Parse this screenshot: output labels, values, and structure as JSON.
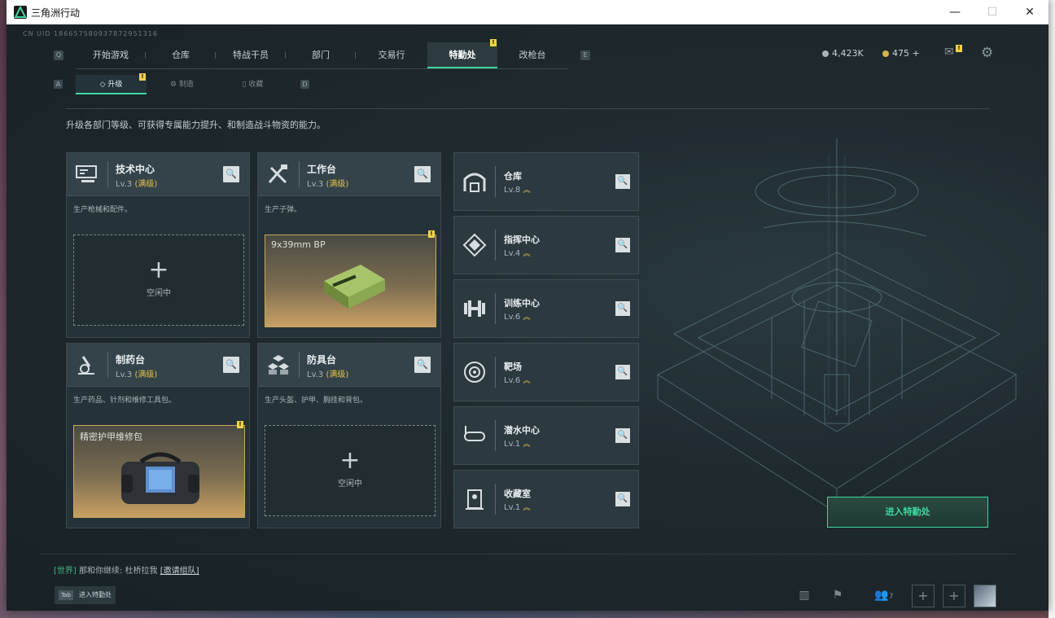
{
  "window": {
    "title": "三角洲行动",
    "controls": {
      "minimize": "—",
      "maximize": "☐",
      "close": "✕"
    }
  },
  "uid": "CN UID 186657580937872951316",
  "nav": {
    "key_left": "Q",
    "key_right": "E",
    "tabs": [
      "开始游戏",
      "仓库",
      "特战干员",
      "部门",
      "交易行",
      "特勤处",
      "改枪台"
    ],
    "active_tab": "特勤处",
    "active_badge": "!"
  },
  "currency": {
    "silver": "4,423K",
    "gold": "475",
    "gold_add": "+"
  },
  "mail_badge": "!",
  "subnav": {
    "key_left": "A",
    "key_right": "D",
    "tabs": [
      "升级",
      "制造",
      "收藏"
    ],
    "active": "升级",
    "badge": "!"
  },
  "description": "升级各部门等级、可获得专属能力提升、和制造战斗物资的能力。",
  "workbenches": [
    {
      "name": "技术中心",
      "level": "Lv.3",
      "max": "(满级)",
      "sub": "生产枪械和配件。",
      "slot": "idle",
      "idle_text": "空闲中",
      "icon": "tech-center-icon"
    },
    {
      "name": "工作台",
      "level": "Lv.3",
      "max": "(满级)",
      "sub": "生产子弹。",
      "slot": "item",
      "item_name": "9x39mm BP",
      "badge": "!",
      "icon": "workbench-icon"
    },
    {
      "name": "制药台",
      "level": "Lv.3",
      "max": "(满级)",
      "sub": "生产药品、针剂和维修工具包。",
      "slot": "item",
      "item_name": "精密护甲维修包",
      "badge": "!",
      "icon": "pharmacy-icon"
    },
    {
      "name": "防具台",
      "level": "Lv.3",
      "max": "(满级)",
      "sub": "生产头盔、护甲、胸挂和背包。",
      "slot": "idle",
      "idle_text": "空闲中",
      "icon": "armor-bench-icon"
    }
  ],
  "facilities": [
    {
      "name": "仓库",
      "level": "Lv.8",
      "icon": "warehouse-icon"
    },
    {
      "name": "指挥中心",
      "level": "Lv.4",
      "icon": "command-center-icon"
    },
    {
      "name": "训练中心",
      "level": "Lv.6",
      "icon": "training-center-icon"
    },
    {
      "name": "靶场",
      "level": "Lv.6",
      "icon": "shooting-range-icon"
    },
    {
      "name": "潜水中心",
      "level": "Lv.1",
      "icon": "dive-center-icon"
    },
    {
      "name": "收藏室",
      "level": "Lv.1",
      "icon": "collection-room-icon"
    }
  ],
  "level_up_mark": "︽",
  "enter_button": "进入特勤处",
  "chat": {
    "channel": "[世界]",
    "message": "那和你继续: 杜桥拉我",
    "link": "[邀请组队]"
  },
  "tab_hint": {
    "key": "Tab",
    "label": "进入特勤处"
  },
  "social": {
    "friends_count": "7"
  },
  "colors": {
    "accent": "#3fd7a0",
    "max_level": "#e6c14a",
    "badge": "#f0d24a"
  }
}
